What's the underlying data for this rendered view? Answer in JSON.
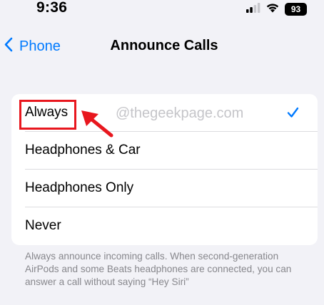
{
  "status_bar": {
    "time": "9:36",
    "battery_level": "93",
    "icons": [
      "cellular-signal-icon",
      "wifi-icon",
      "battery-icon"
    ]
  },
  "nav": {
    "back_label": "Phone",
    "title": "Announce Calls"
  },
  "options": [
    {
      "label": "Always",
      "selected": true
    },
    {
      "label": "Headphones & Car",
      "selected": false
    },
    {
      "label": "Headphones Only",
      "selected": false
    },
    {
      "label": "Never",
      "selected": false
    }
  ],
  "footer_note": "Always announce incoming calls. When second-generation AirPods and some Beats headphones are connected, you can answer a call without saying “Hey Siri”",
  "watermark": "@thegeekpage.com",
  "colors": {
    "accent": "#007aff",
    "background": "#f2f2f7",
    "annotation": "#e8171e"
  }
}
